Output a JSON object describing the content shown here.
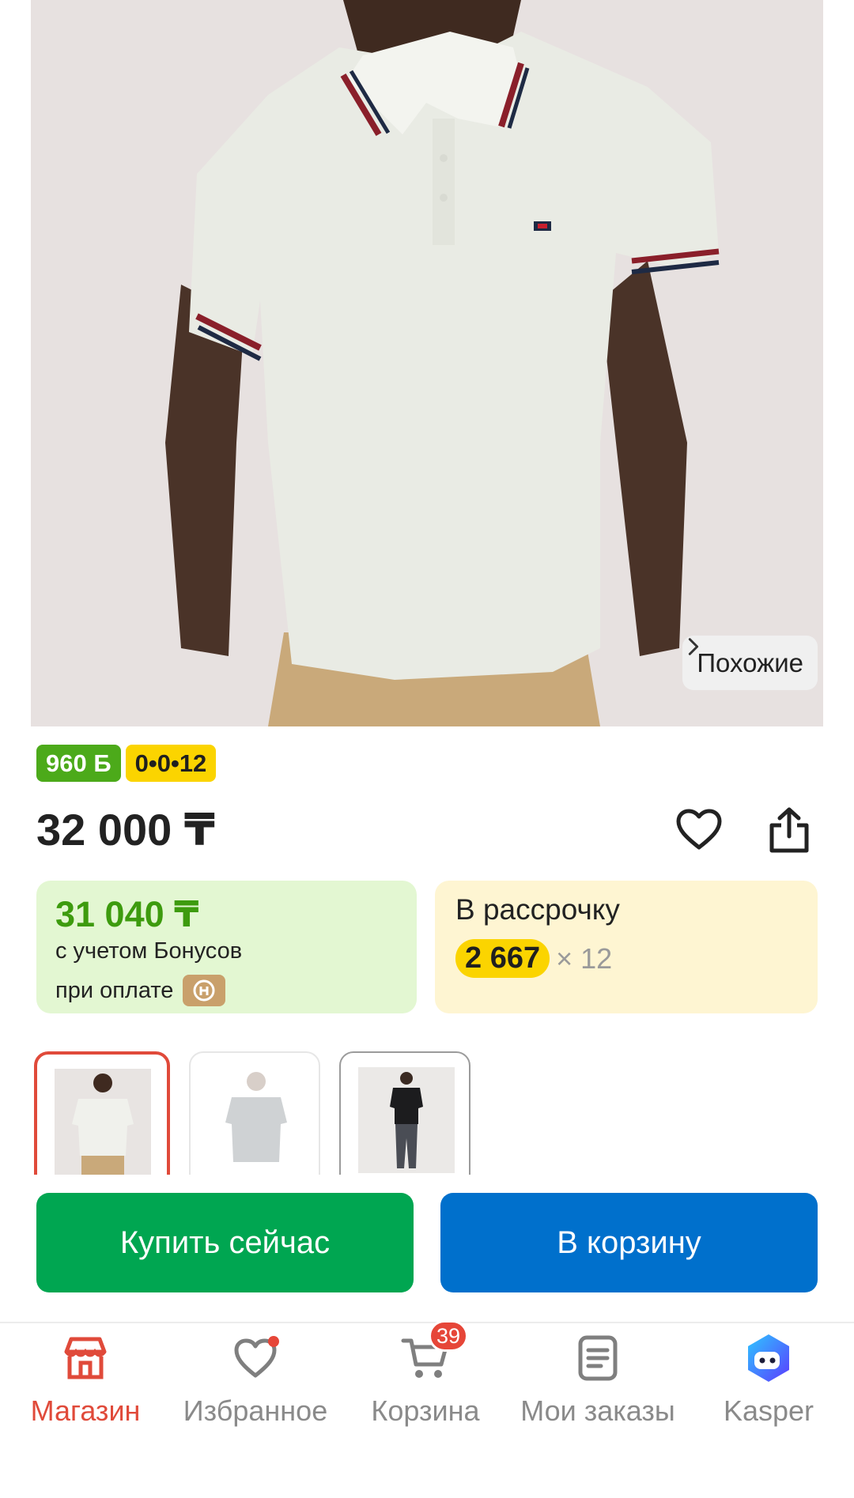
{
  "product": {
    "image_alt": "white polo shirt with striped collar",
    "similar_label": "Похожие",
    "badges": {
      "bonus": "960 Б",
      "installment": "0•0•12"
    },
    "price": "32 000 ₸"
  },
  "bonus_card": {
    "price": "31 040 ₸",
    "line1": "с учетом Бонусов",
    "line2": "при оплате"
  },
  "installment_card": {
    "title": "В рассрочку",
    "amount": "2 667",
    "multiplier": "× 12"
  },
  "actions": {
    "buy_now": "Купить сейчас",
    "add_to_cart": "В корзину"
  },
  "nav": {
    "items": [
      {
        "label": "Магазин",
        "icon": "shop-icon",
        "active": true
      },
      {
        "label": "Избранное",
        "icon": "heart-icon",
        "active": false
      },
      {
        "label": "Корзина",
        "icon": "cart-icon",
        "active": false,
        "badge": "39"
      },
      {
        "label": "Мои заказы",
        "icon": "orders-icon",
        "active": false
      },
      {
        "label": "Kasper",
        "icon": "kasper-assistant-icon",
        "active": false
      }
    ]
  },
  "colors": {
    "accent_red": "#e04a3a",
    "buy_green": "#00a651",
    "cart_blue": "#0070cc",
    "bonus_green": "#3d9b0e",
    "installment_yellow": "#fbd400"
  }
}
